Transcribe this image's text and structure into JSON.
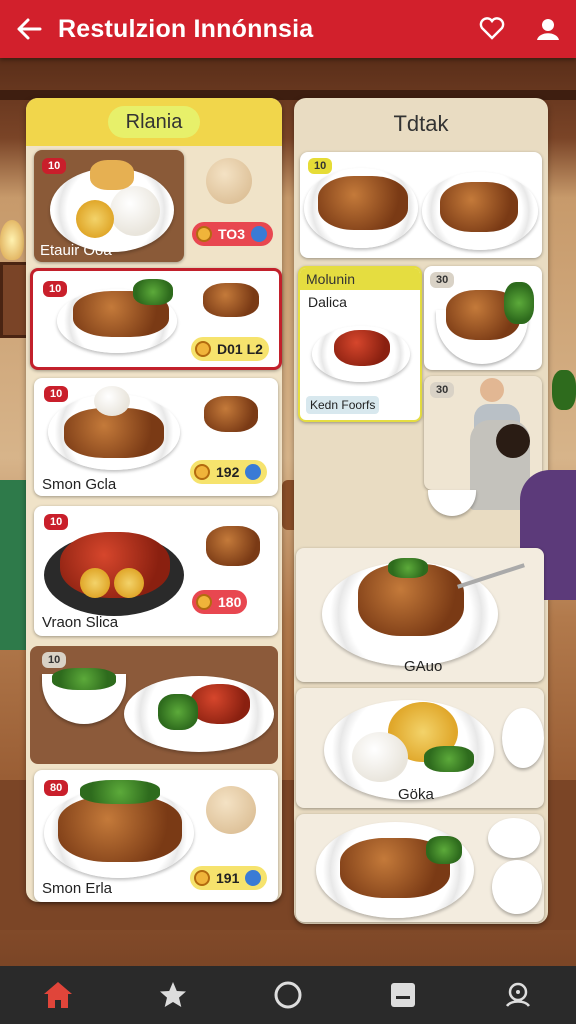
{
  "header": {
    "back_icon": "arrow-left-icon",
    "title": "Restulzion Innónnsia",
    "favorite_icon": "heart-icon",
    "profile_icon": "user-icon"
  },
  "left_panel": {
    "tab": "Rlania",
    "cards": [
      {
        "badge": "10",
        "label": "Etauir Ooa",
        "price": "TO3"
      },
      {
        "badge": "10",
        "label": "",
        "price": "D01 L2"
      },
      {
        "badge": "10",
        "label": "Smon Gcla",
        "price": "192"
      },
      {
        "badge": "10",
        "label": "Vraon Slica",
        "price": "180"
      },
      {
        "badge": "10",
        "label": "",
        "price": ""
      },
      {
        "badge": "80",
        "label": "Smon Erla",
        "price": "191"
      }
    ]
  },
  "right_panel": {
    "title": "Tdtak",
    "cards": [
      {
        "badge": "10"
      },
      {
        "badge": "",
        "tag": "Molunin",
        "subtitle": "Dalica",
        "footer": "Kedn Foorfs"
      },
      {
        "badge": "30"
      },
      {
        "badge": "30"
      },
      {
        "label": "GAuo"
      },
      {
        "label": "Göka"
      }
    ]
  },
  "nav": {
    "items": [
      {
        "icon": "home-icon",
        "active_color": "#e0453a"
      },
      {
        "icon": "star-icon"
      },
      {
        "icon": "circle-icon"
      },
      {
        "icon": "card-icon"
      },
      {
        "icon": "location-icon"
      }
    ]
  },
  "colors": {
    "accent": "#d2202c",
    "panel_header": "#f1d64b",
    "nav_bg": "#2a2a2a"
  }
}
